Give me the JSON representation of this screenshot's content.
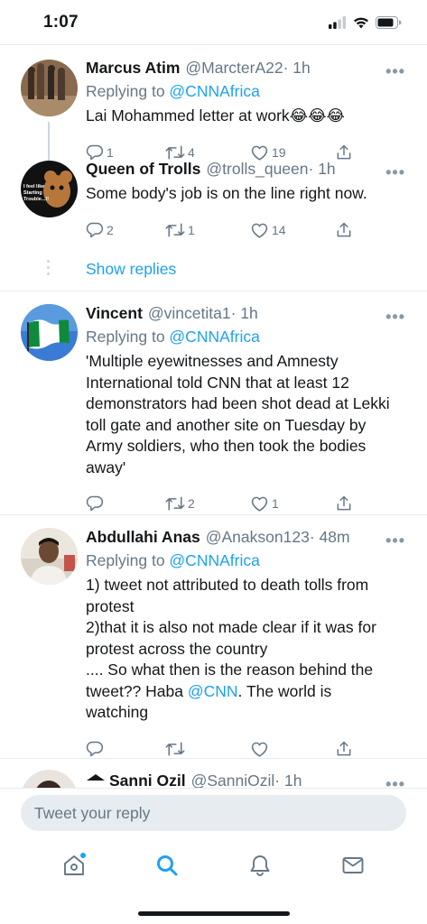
{
  "status_bar": {
    "time": "1:07"
  },
  "tweets": [
    {
      "name": "Marcus Atim",
      "handle": "@MarcterA22",
      "time": "· 1h",
      "replying_prefix": "Replying to ",
      "replying_to": "@CNNAfrica",
      "text": "Lai Mohammed letter at work😂😂😂",
      "replies": "1",
      "retweets": "4",
      "likes": "19"
    },
    {
      "name": "Queen of Trolls",
      "handle": "@trolls_queen",
      "time": "· 1h",
      "avatar_text": "I feel like Starting Trouble...!!",
      "text": "Some body's job is on the line right now.",
      "replies": "2",
      "retweets": "1",
      "likes": "14"
    },
    {
      "name": "Vincent",
      "handle": "@vincetita1",
      "time": "· 1h",
      "replying_prefix": "Replying to ",
      "replying_to": "@CNNAfrica",
      "text": "'Multiple eyewitnesses and Amnesty International told CNN that at least 12 demonstrators had been shot dead at Lekki toll gate and another site on Tuesday by Army soldiers, who then took the bodies away'",
      "replies": "",
      "retweets": "2",
      "likes": "1"
    },
    {
      "name": "Abdullahi Anas",
      "handle": "@Anakson123",
      "time": "· 48m",
      "replying_prefix": "Replying to ",
      "replying_to": "@CNNAfrica",
      "text_lines": [
        "1) tweet not attributed to death tolls from protest",
        "2)that it is also not made clear if it was for protest across the country",
        ".... So what then is the reason behind the tweet?? Haba "
      ],
      "mention": "@CNN",
      "text_tail": ". The world is watching",
      "replies": "",
      "retweets": "",
      "likes": ""
    },
    {
      "name": "Sanni Ozil",
      "handle": "@SanniOzil",
      "time": "· 1h"
    }
  ],
  "show_replies": "Show replies",
  "more_glyph": "•••",
  "composer": {
    "placeholder": "Tweet your reply"
  },
  "tabs": {
    "home": "home-icon",
    "search": "search-icon",
    "notifications": "bell-icon",
    "messages": "mail-icon"
  },
  "colors": {
    "accent": "#1da1f2",
    "secondary_text": "#657786",
    "divider": "#e6ecf0"
  }
}
